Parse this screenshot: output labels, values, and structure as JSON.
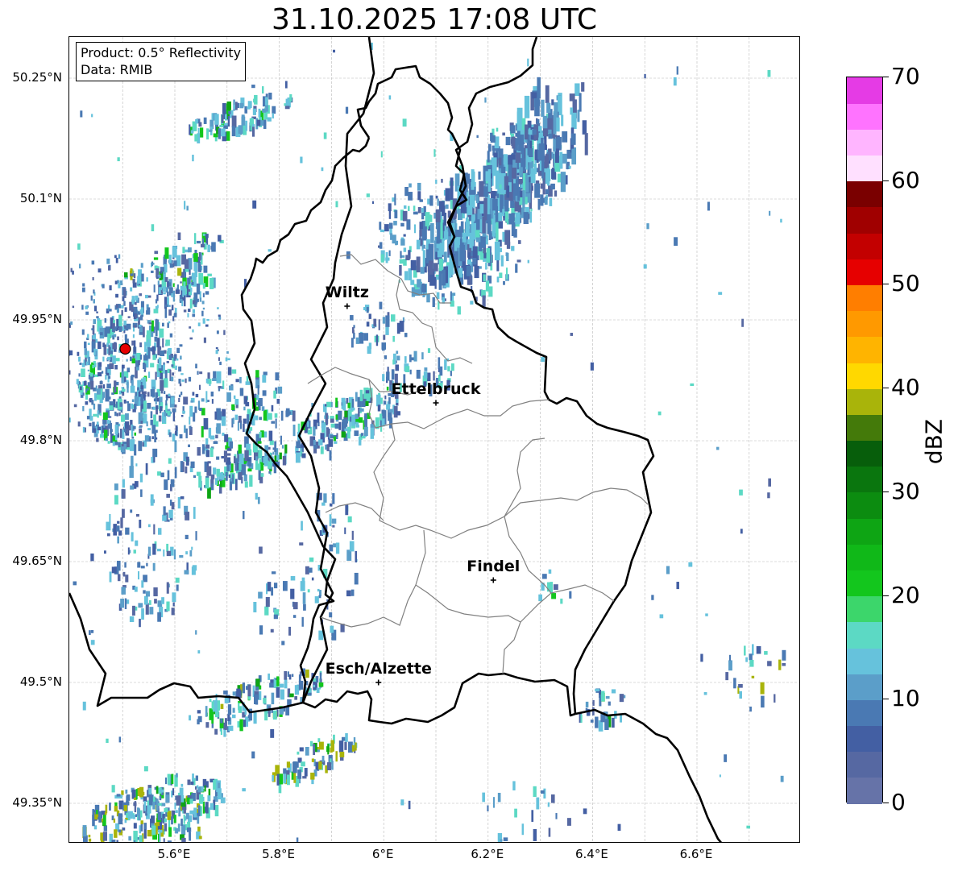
{
  "title": "31.10.2025 17:08 UTC",
  "info": {
    "product": "Product: 0.5° Reflectivity",
    "source": "Data: RMIB"
  },
  "lat_labels": [
    "50.25°N",
    "50.1°N",
    "49.95°N",
    "49.8°N",
    "49.65°N",
    "49.5°N",
    "49.35°N"
  ],
  "lon_labels": [
    "5.6°E",
    "5.8°E",
    "6°E",
    "6.2°E",
    "6.4°E",
    "6.6°E"
  ],
  "cities": [
    {
      "name": "Wiltz",
      "lon": 5.93,
      "lat": 49.967
    },
    {
      "name": "Ettelbruck",
      "lon": 6.1,
      "lat": 49.847
    },
    {
      "name": "Findel",
      "lon": 6.21,
      "lat": 49.627
    },
    {
      "name": "Esch/Alzette",
      "lon": 5.99,
      "lat": 49.5
    }
  ],
  "radar_site": {
    "lon": 5.505,
    "lat": 49.914,
    "color": "#e60000"
  },
  "colorbar": {
    "label": "dBZ",
    "min": 0,
    "max": 70,
    "step": 2.5,
    "tick_labels": [
      "0",
      "10",
      "20",
      "30",
      "40",
      "50",
      "60",
      "70"
    ],
    "colors": [
      "#6673a8",
      "#5668a2",
      "#435fa3",
      "#4a79b3",
      "#5b9ec9",
      "#66c2dc",
      "#5cd9c4",
      "#3cd66b",
      "#13c61d",
      "#10b818",
      "#0ea514",
      "#0c8c10",
      "#0a760e",
      "#075e0b",
      "#447a0a",
      "#a9b40a",
      "#ffd800",
      "#ffb400",
      "#ff9900",
      "#ff7e00",
      "#e60000",
      "#c30000",
      "#a00000",
      "#7a0000",
      "#ffe0ff",
      "#ffb5ff",
      "#ff73ff",
      "#e53be5"
    ]
  }
}
